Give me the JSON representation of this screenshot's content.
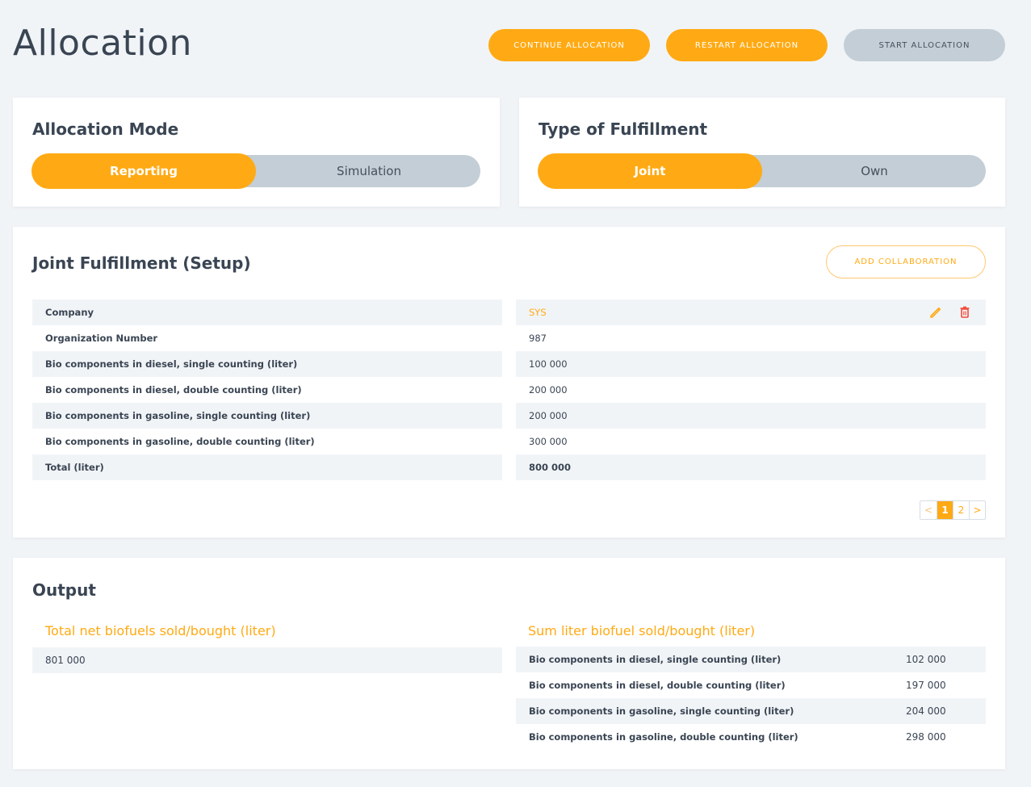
{
  "page": {
    "title": "Allocation"
  },
  "actions": {
    "continue_label": "CONTINUE ALLOCATION",
    "restart_label": "RESTART ALLOCATION",
    "start_label": "START ALLOCATION"
  },
  "allocation_mode": {
    "title": "Allocation Mode",
    "options": [
      "Reporting",
      "Simulation"
    ],
    "selected": "Reporting"
  },
  "fulfillment_type": {
    "title": "Type of Fulfillment",
    "options": [
      "Joint",
      "Own"
    ],
    "selected": "Joint"
  },
  "setup": {
    "title": "Joint Fulfillment (Setup)",
    "add_label": "ADD COLLABORATION",
    "rows": [
      {
        "label": "Company",
        "value": "SYS"
      },
      {
        "label": "Organization Number",
        "value": "987"
      },
      {
        "label": "Bio components in diesel, single counting (liter)",
        "value": "100 000"
      },
      {
        "label": "Bio components in diesel, double counting (liter)",
        "value": "200 000"
      },
      {
        "label": "Bio components in gasoline, single counting (liter)",
        "value": "200 000"
      },
      {
        "label": "Bio components in gasoline, double counting (liter)",
        "value": "300 000"
      },
      {
        "label": "Total (liter)",
        "value": "800 000"
      }
    ],
    "pagination": {
      "prev": "<",
      "pages": [
        "1",
        "2"
      ],
      "current": "1",
      "next": ">"
    }
  },
  "output": {
    "title": "Output",
    "total_heading": "Total net biofuels sold/bought (liter)",
    "total_value": "801 000",
    "sum_heading": "Sum liter biofuel sold/bought (liter)",
    "sum_rows": [
      {
        "label": "Bio components in diesel, single counting (liter)",
        "value": "102 000"
      },
      {
        "label": "Bio components in diesel, double counting (liter)",
        "value": "197 000"
      },
      {
        "label": "Bio components in gasoline, single counting (liter)",
        "value": "204 000"
      },
      {
        "label": "Bio components in gasoline, double counting (liter)",
        "value": "298 000"
      }
    ]
  },
  "colors": {
    "accent": "#ffaa14",
    "muted": "#c3ced6",
    "danger": "#f04a3a",
    "background": "#f1f4f7"
  },
  "icons": [
    "edit-icon",
    "delete-icon"
  ]
}
